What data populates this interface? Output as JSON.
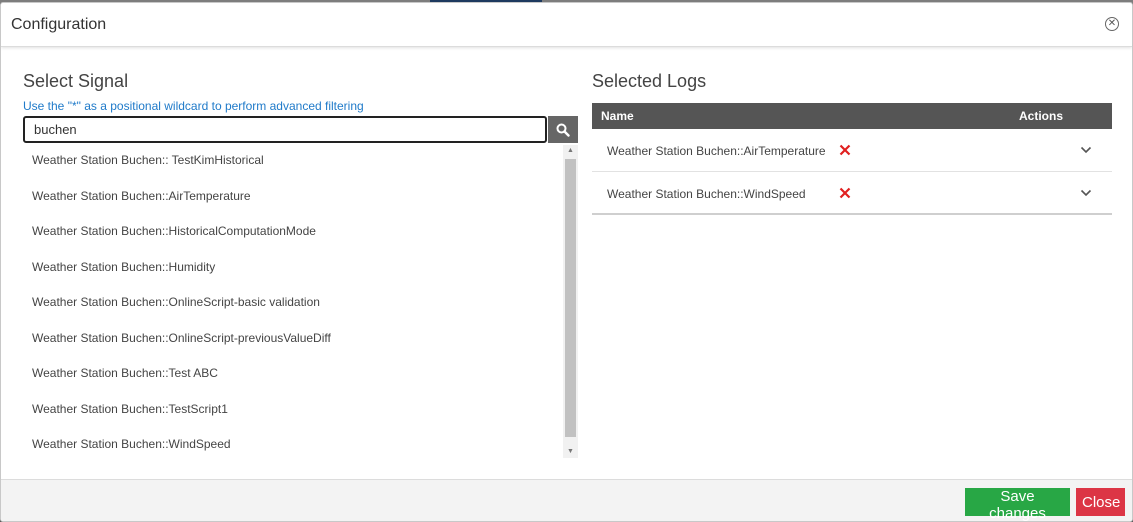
{
  "modal": {
    "title": "Configuration"
  },
  "left": {
    "title": "Select Signal",
    "hint": "Use the \"*\" as a positional wildcard to perform advanced filtering",
    "search": {
      "value": "buchen",
      "placeholder": ""
    },
    "signals": [
      "Weather Station Buchen:: TestKimHistorical",
      "Weather Station Buchen::AirTemperature",
      "Weather Station Buchen::HistoricalComputationMode",
      "Weather Station Buchen::Humidity",
      "Weather Station Buchen::OnlineScript-basic validation",
      "Weather Station Buchen::OnlineScript-previousValueDiff",
      "Weather Station Buchen::Test ABC",
      "Weather Station Buchen::TestScript1",
      "Weather Station Buchen::WindSpeed"
    ]
  },
  "right": {
    "title": "Selected Logs",
    "columns": {
      "name": "Name",
      "actions": "Actions"
    },
    "logs": [
      {
        "name": "Weather Station Buchen::AirTemperature"
      },
      {
        "name": "Weather Station Buchen::WindSpeed"
      }
    ]
  },
  "footer": {
    "save_label": "Save changes",
    "close_label": "Close"
  },
  "colors": {
    "save": "#28a745",
    "close": "#dc3545",
    "hint": "#1f7ac9",
    "header": "#555555",
    "remove": "#e02020"
  },
  "icons": {
    "close": "close-circle-icon",
    "search": "search-icon",
    "remove": "remove-x-icon",
    "expand": "chevron-down-icon"
  }
}
